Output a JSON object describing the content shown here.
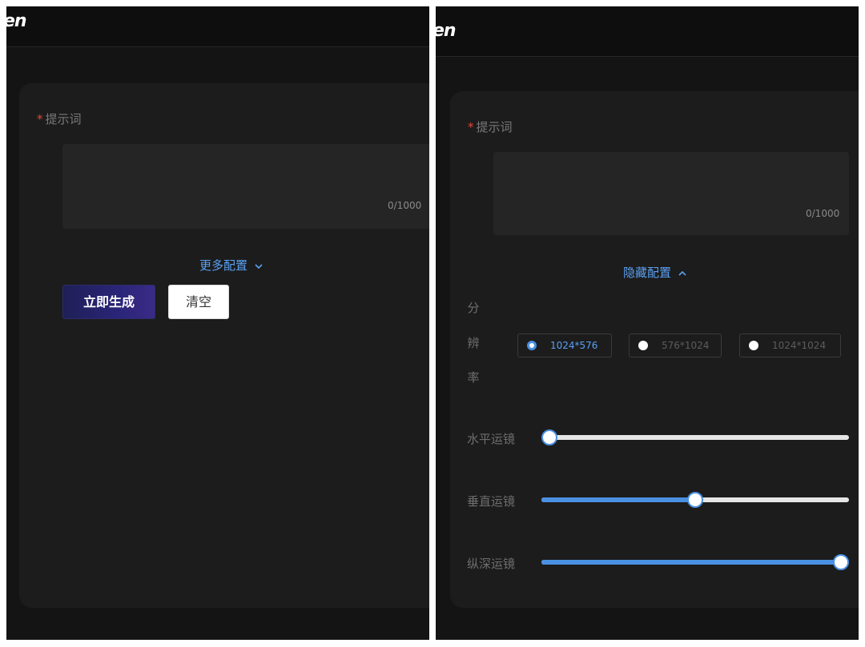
{
  "left_panel": {
    "logo_text": "en",
    "prompt": {
      "required_mark": "*",
      "label": "提示词",
      "value": "",
      "counter": "0/1000"
    },
    "more_config_label": "更多配置",
    "generate_label": "立即生成",
    "clear_label": "清空"
  },
  "right_panel": {
    "logo_text": "en",
    "prompt": {
      "required_mark": "*",
      "label": "提示词",
      "value": "",
      "counter": "0/1000"
    },
    "hide_config_label": "隐藏配置",
    "resolution": {
      "label_chars": [
        "分",
        "辨",
        "率"
      ],
      "options": [
        {
          "label": "1024*576",
          "selected": true
        },
        {
          "label": "576*1024",
          "selected": false
        },
        {
          "label": "1024*1024",
          "selected": false
        }
      ]
    },
    "sliders": [
      {
        "label": "水平运镜",
        "value_fraction": 0.0
      },
      {
        "label": "垂直运镜",
        "value_fraction": 0.5
      },
      {
        "label": "纵深运镜",
        "value_fraction": 1.0
      }
    ]
  },
  "colors": {
    "accent": "#4a90e2",
    "link": "#5aa0f2",
    "required": "#e0483a",
    "panel_bg": "#141414",
    "card_bg": "#1c1c1c"
  }
}
